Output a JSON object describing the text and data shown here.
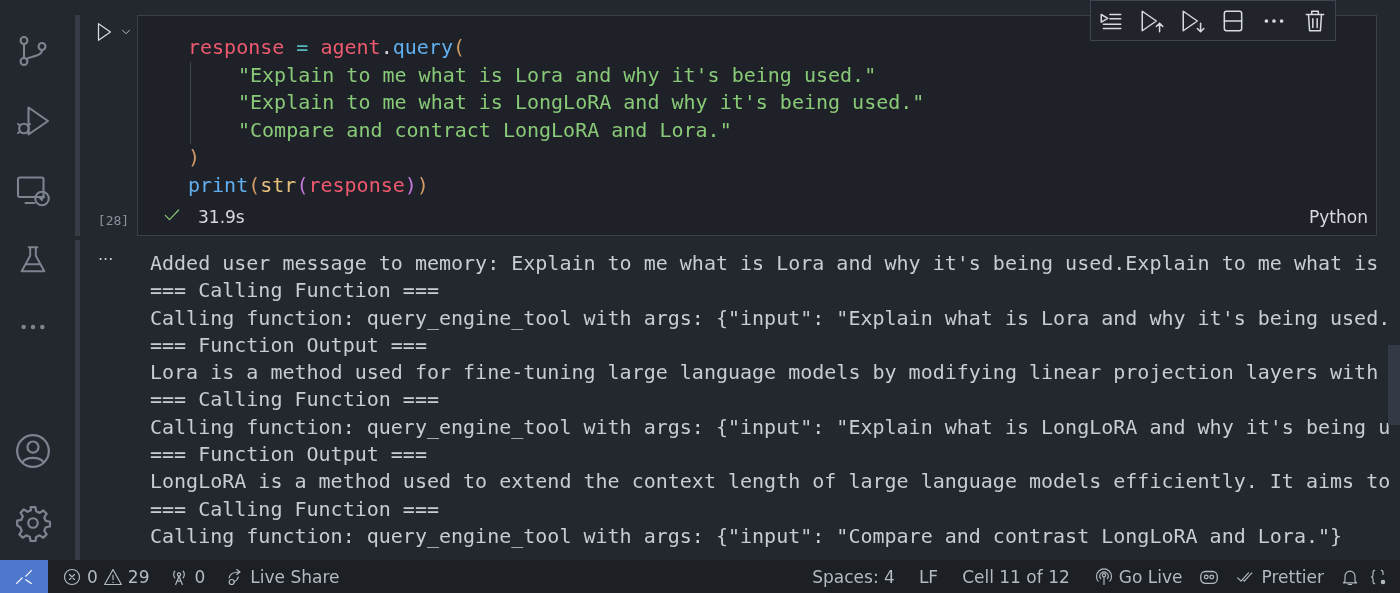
{
  "cell": {
    "code_lines": [
      {
        "indented": false,
        "tokens": [
          {
            "kind": "var",
            "text": "response"
          },
          {
            "kind": "op",
            "text": " = "
          },
          {
            "kind": "var",
            "text": "agent"
          },
          {
            "kind": "punc",
            "text": "."
          },
          {
            "kind": "func",
            "text": "query"
          },
          {
            "kind": "bracket",
            "text": "("
          }
        ]
      },
      {
        "indented": true,
        "tokens": [
          {
            "kind": "str",
            "text": "\"Explain to me what is Lora and why it's being used.\""
          }
        ]
      },
      {
        "indented": true,
        "tokens": [
          {
            "kind": "str",
            "text": "\"Explain to me what is LongLoRA and why it's being used.\""
          }
        ]
      },
      {
        "indented": true,
        "tokens": [
          {
            "kind": "str",
            "text": "\"Compare and contract LongLoRA and Lora.\""
          }
        ]
      },
      {
        "indented": false,
        "tokens": [
          {
            "kind": "bracket",
            "text": ")"
          }
        ]
      },
      {
        "indented": false,
        "tokens": [
          {
            "kind": "func",
            "text": "print"
          },
          {
            "kind": "bracket",
            "text": "("
          },
          {
            "kind": "builtin",
            "text": "str"
          },
          {
            "kind": "bracket2",
            "text": "("
          },
          {
            "kind": "var",
            "text": "response"
          },
          {
            "kind": "bracket2",
            "text": ")"
          },
          {
            "kind": "bracket",
            "text": ")"
          }
        ]
      }
    ],
    "execution_count": "[28]",
    "duration": "31.9s",
    "language": "Python"
  },
  "output": {
    "more": "···",
    "lines": [
      "Added user message to memory: Explain to me what is Lora and why it's being used.Explain to me what is",
      "=== Calling Function ===",
      "Calling function: query_engine_tool with args: {\"input\": \"Explain what is Lora and why it's being used.",
      "=== Function Output ===",
      "Lora is a method used for fine-tuning large language models by modifying linear projection layers with",
      "=== Calling Function ===",
      "Calling function: query_engine_tool with args: {\"input\": \"Explain what is LongLoRA and why it's being u",
      "=== Function Output ===",
      "LongLoRA is a method used to extend the context length of large language models efficiently. It aims to",
      "=== Calling Function ===",
      "Calling function: query_engine_tool with args: {\"input\": \"Compare and contrast LongLoRA and Lora.\"}"
    ]
  },
  "status_bar": {
    "errors": "0",
    "warnings": "29",
    "ports": "0",
    "live_share": "Live Share",
    "spaces": "Spaces: 4",
    "eol": "LF",
    "cell_position": "Cell 11 of 12",
    "go_live": "Go Live",
    "prettier": "Prettier"
  }
}
